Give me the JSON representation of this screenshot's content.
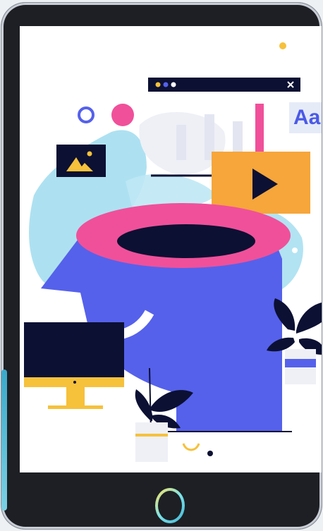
{
  "illustration": {
    "font_badge_text": "Aa",
    "colors": {
      "head": "#5561eb",
      "rim": "#f0509a",
      "navy": "#0c1033",
      "yellow": "#f6b93b",
      "orange": "#f6a63a",
      "cyan": "#8fd3ea"
    },
    "icons": [
      "image-icon",
      "play-icon",
      "close-icon",
      "monitor-icon",
      "plant-icon"
    ]
  }
}
